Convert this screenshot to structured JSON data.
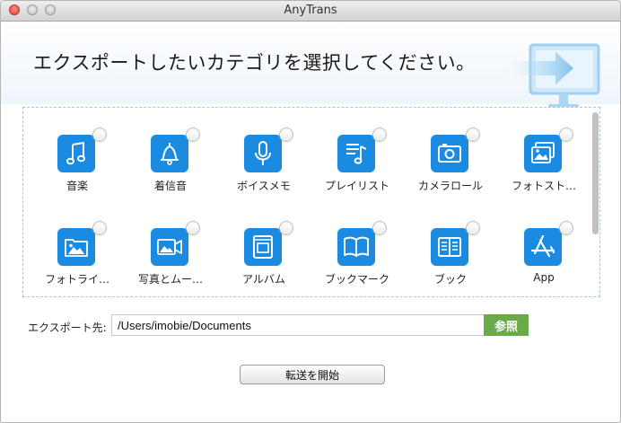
{
  "window": {
    "title": "AnyTrans"
  },
  "header": {
    "title": "エクスポートしたいカテゴリを選択してください。"
  },
  "categories": [
    {
      "label": "音楽",
      "icon": "music-note-icon"
    },
    {
      "label": "着信音",
      "icon": "bell-icon"
    },
    {
      "label": "ボイスメモ",
      "icon": "microphone-icon"
    },
    {
      "label": "プレイリスト",
      "icon": "playlist-icon"
    },
    {
      "label": "カメラロール",
      "icon": "camera-icon"
    },
    {
      "label": "フォトスト…",
      "icon": "photo-stream-icon"
    },
    {
      "label": "フォトライ…",
      "icon": "photo-library-icon"
    },
    {
      "label": "写真とムー…",
      "icon": "photo-video-icon"
    },
    {
      "label": "アルバム",
      "icon": "album-icon"
    },
    {
      "label": "ブックマーク",
      "icon": "open-book-icon"
    },
    {
      "label": "ブック",
      "icon": "book-icon"
    },
    {
      "label": "App",
      "icon": "app-store-icon"
    }
  ],
  "export": {
    "label": "エクスポート先:",
    "path": "/Users/imobie/Documents",
    "browse_label": "参照"
  },
  "actions": {
    "start_label": "転送を開始"
  },
  "colors": {
    "accent": "#1a8be0",
    "browse": "#6aaa4a"
  }
}
